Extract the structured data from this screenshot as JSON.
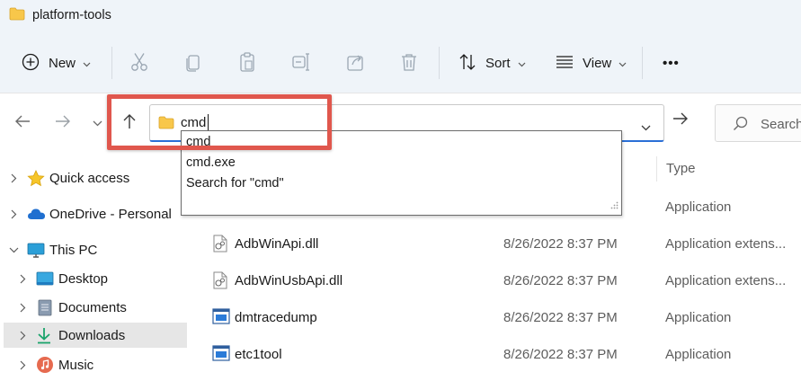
{
  "window": {
    "title": "platform-tools"
  },
  "toolbar": {
    "new_label": "New",
    "sort_label": "Sort",
    "view_label": "View",
    "more_label": "•••"
  },
  "address": {
    "value": "cmd"
  },
  "search": {
    "placeholder": "Search"
  },
  "autocomplete": {
    "items": [
      {
        "label": "cmd"
      },
      {
        "label": "cmd.exe"
      },
      {
        "label": "Search for \"cmd\""
      }
    ]
  },
  "sidebar": {
    "items": [
      {
        "label": "Quick access"
      },
      {
        "label": "OneDrive - Personal"
      },
      {
        "label": "This PC"
      },
      {
        "label": "Desktop"
      },
      {
        "label": "Documents"
      },
      {
        "label": "Downloads"
      },
      {
        "label": "Music"
      }
    ]
  },
  "columns": {
    "type": "Type"
  },
  "files": [
    {
      "name": "",
      "date": "",
      "type": "Application"
    },
    {
      "name": "AdbWinApi.dll",
      "date": "8/26/2022 8:37 PM",
      "type": "Application extens..."
    },
    {
      "name": "AdbWinUsbApi.dll",
      "date": "8/26/2022 8:37 PM",
      "type": "Application extens..."
    },
    {
      "name": "dmtracedump",
      "date": "8/26/2022 8:37 PM",
      "type": "Application"
    },
    {
      "name": "etc1tool",
      "date": "8/26/2022 8:37 PM",
      "type": "Application"
    }
  ],
  "colors": {
    "accent": "#2a6fd6",
    "highlight_box": "#e0574d",
    "folder": "#f8c74a",
    "toolbar_bg": "#eff4f9"
  }
}
